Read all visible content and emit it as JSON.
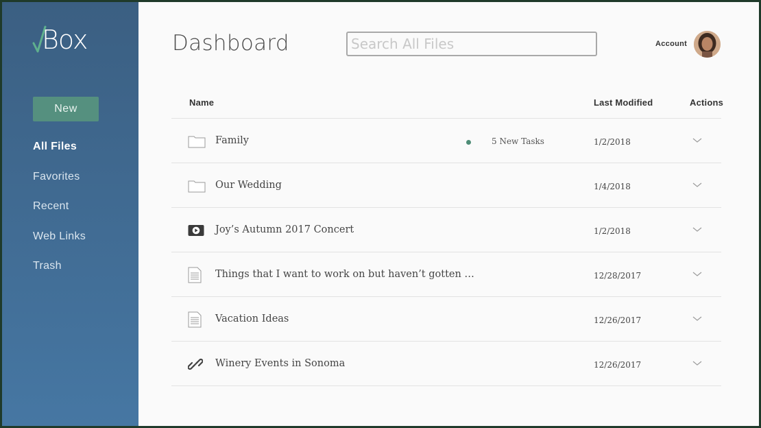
{
  "app": {
    "logo_text": "Box"
  },
  "sidebar": {
    "new_label": "New",
    "items": [
      {
        "label": "All Files",
        "active": true
      },
      {
        "label": "Favorites",
        "active": false
      },
      {
        "label": "Recent",
        "active": false
      },
      {
        "label": "Web Links",
        "active": false
      },
      {
        "label": "Trash",
        "active": false
      }
    ]
  },
  "header": {
    "title": "Dashboard",
    "search_placeholder": "Search All Files",
    "account_label": "Account"
  },
  "table": {
    "columns": {
      "name": "Name",
      "last_modified": "Last Modified",
      "actions": "Actions"
    },
    "rows": [
      {
        "icon": "folder-icon",
        "name": "Family",
        "tasks": "5 New Tasks",
        "modified": "1/2/2018"
      },
      {
        "icon": "folder-icon",
        "name": "Our Wedding",
        "tasks": "",
        "modified": "1/4/2018"
      },
      {
        "icon": "video-icon",
        "name": "Joy’s Autumn 2017 Concert",
        "tasks": "",
        "modified": "1/2/2018"
      },
      {
        "icon": "document-icon",
        "name": "Things that I want to work on but haven’t gotten …",
        "tasks": "",
        "modified": "12/28/2017"
      },
      {
        "icon": "document-icon",
        "name": "Vacation Ideas",
        "tasks": "",
        "modified": "12/26/2017"
      },
      {
        "icon": "link-icon",
        "name": "Winery Events in Sonoma",
        "tasks": "",
        "modified": "12/26/2017"
      }
    ]
  },
  "colors": {
    "sidebar_top": "#3b5f82",
    "sidebar_bottom": "#4677a3",
    "accent_green": "#55907f",
    "task_dot": "#4e8c76"
  }
}
